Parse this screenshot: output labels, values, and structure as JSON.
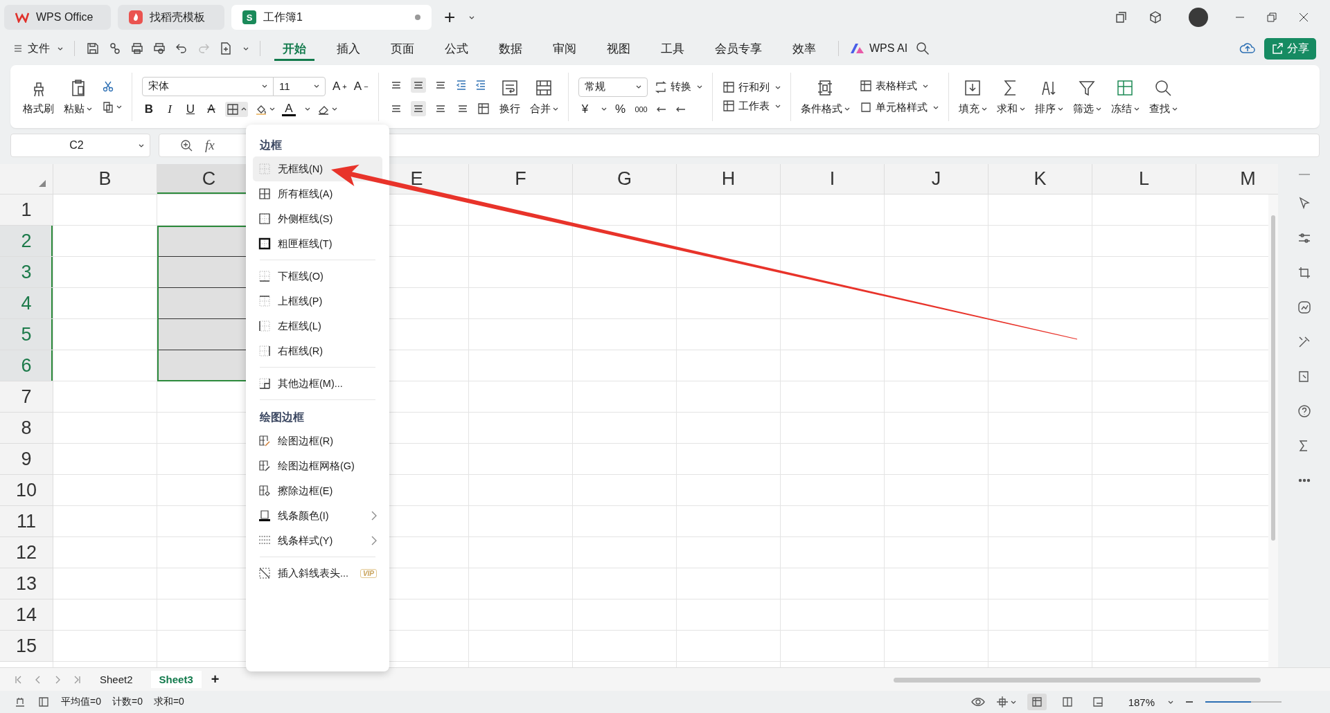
{
  "window_tabs": [
    {
      "kind": "home",
      "label": "WPS Office",
      "selected": false,
      "modified": false
    },
    {
      "kind": "template",
      "label": "找稻壳模板",
      "selected": false,
      "modified": false
    },
    {
      "kind": "sheet",
      "badge": "S",
      "label": "工作簿1",
      "selected": true,
      "modified": true
    }
  ],
  "new_tab": "+",
  "file_menu": "文件",
  "menu_tabs": [
    {
      "label": "开始",
      "selected": true
    },
    {
      "label": "插入",
      "selected": false
    },
    {
      "label": "页面",
      "selected": false
    },
    {
      "label": "公式",
      "selected": false
    },
    {
      "label": "数据",
      "selected": false
    },
    {
      "label": "审阅",
      "selected": false
    },
    {
      "label": "视图",
      "selected": false
    },
    {
      "label": "工具",
      "selected": false
    },
    {
      "label": "会员专享",
      "selected": false
    },
    {
      "label": "效率",
      "selected": false
    }
  ],
  "ai_button": "WPS AI",
  "share_button": "分享",
  "ribbon": {
    "format_painter": {
      "label": "格式刷",
      "dropdown": false
    },
    "paste": {
      "label": "粘贴",
      "dropdown": true
    },
    "font_name": "宋体",
    "font_size": "11",
    "grow": "A",
    "grow_sign": "+",
    "shrink": "A",
    "shrink_sign": "−",
    "bold": "B",
    "italic": "I",
    "underline": "U",
    "strike": "A",
    "font_color": "A",
    "wrap": {
      "label": "换行",
      "dropdown": false
    },
    "merge": {
      "label": "合并",
      "dropdown": true
    },
    "number_format": "常规",
    "convert": {
      "label": "转换",
      "dropdown": true
    },
    "currency": "¥",
    "percent": "%",
    "thousands": "000",
    "rows_cols": {
      "label": "行和列",
      "dropdown": true
    },
    "worksheet": {
      "label": "工作表",
      "dropdown": true
    },
    "conditional": {
      "label": "条件格式",
      "dropdown": true
    },
    "table_style": {
      "label": "表格样式",
      "dropdown": true
    },
    "cell_style": {
      "label": "单元格样式",
      "dropdown": true
    },
    "right_buttons": [
      {
        "label": "填充",
        "dropdown": true
      },
      {
        "label": "求和",
        "dropdown": true
      },
      {
        "label": "排序",
        "dropdown": true
      },
      {
        "label": "筛选",
        "dropdown": true
      },
      {
        "label": "冻结",
        "dropdown": true
      },
      {
        "label": "查找",
        "dropdown": true
      }
    ]
  },
  "name_box": "C2",
  "formula_label": "fx",
  "columns": [
    {
      "label": "B",
      "selected": false
    },
    {
      "label": "C",
      "selected": true
    },
    {},
    {
      "label": "E",
      "selected": false
    },
    {
      "label": "F",
      "selected": false
    },
    {
      "label": "G",
      "selected": false
    },
    {
      "label": "H",
      "selected": false
    },
    {
      "label": "I",
      "selected": false
    },
    {
      "label": "J",
      "selected": false
    },
    {
      "label": "K",
      "selected": false
    },
    {
      "label": "L",
      "selected": false
    },
    {
      "label": "M",
      "selected": false
    }
  ],
  "rows": [
    {
      "label": "1",
      "selected": false
    },
    {
      "label": "2",
      "selected": true
    },
    {
      "label": "3",
      "selected": true
    },
    {
      "label": "4",
      "selected": true
    },
    {
      "label": "5",
      "selected": true
    },
    {
      "label": "6",
      "selected": true
    },
    {
      "label": "7",
      "selected": false
    },
    {
      "label": "8",
      "selected": false
    },
    {
      "label": "9",
      "selected": false
    },
    {
      "label": "10",
      "selected": false
    },
    {
      "label": "11",
      "selected": false
    },
    {
      "label": "12",
      "selected": false
    },
    {
      "label": "13",
      "selected": false
    },
    {
      "label": "14",
      "selected": false
    },
    {
      "label": "15",
      "selected": false
    }
  ],
  "border_menu": [
    {
      "kind": "heading",
      "label": "边框"
    },
    {
      "kind": "item",
      "label": "无框线(N)",
      "selected": true,
      "submenu": false
    },
    {
      "kind": "item",
      "label": "所有框线(A)",
      "selected": false,
      "submenu": false
    },
    {
      "kind": "item",
      "label": "外侧框线(S)",
      "selected": false,
      "submenu": false
    },
    {
      "kind": "item",
      "label": "粗匣框线(T)",
      "selected": false,
      "submenu": false
    },
    {
      "kind": "separator"
    },
    {
      "kind": "item",
      "label": "下框线(O)",
      "selected": false,
      "submenu": false
    },
    {
      "kind": "item",
      "label": "上框线(P)",
      "selected": false,
      "submenu": false
    },
    {
      "kind": "item",
      "label": "左框线(L)",
      "selected": false,
      "submenu": false
    },
    {
      "kind": "item",
      "label": "右框线(R)",
      "selected": false,
      "submenu": false
    },
    {
      "kind": "separator"
    },
    {
      "kind": "item",
      "label": "其他边框(M)...",
      "selected": false,
      "submenu": false
    },
    {
      "kind": "separator"
    },
    {
      "kind": "heading",
      "label": "绘图边框"
    },
    {
      "kind": "item",
      "label": "绘图边框(R)",
      "selected": false,
      "submenu": false
    },
    {
      "kind": "item",
      "label": "绘图边框网格(G)",
      "selected": false,
      "submenu": false
    },
    {
      "kind": "item",
      "label": "擦除边框(E)",
      "selected": false,
      "submenu": false
    },
    {
      "kind": "item",
      "label": "线条颜色(I)",
      "selected": false,
      "submenu": true
    },
    {
      "kind": "item",
      "label": "线条样式(Y)",
      "selected": false,
      "submenu": true
    },
    {
      "kind": "separator"
    },
    {
      "kind": "item",
      "label": "插入斜线表头...",
      "selected": false,
      "submenu": false,
      "badge": "VIP"
    }
  ],
  "sheet_tabs": [
    {
      "label": "Sheet2",
      "selected": false
    },
    {
      "label": "Sheet3",
      "selected": true
    }
  ],
  "add_sheet": "+",
  "status_bar": {
    "stats": [
      "平均值=0",
      "计数=0",
      "求和=0"
    ],
    "zoom": "187%",
    "zoom_slider": {
      "level": 0.6
    },
    "view_modes": [
      {
        "selected": true
      },
      {
        "selected": false
      },
      {
        "selected": false
      }
    ]
  }
}
